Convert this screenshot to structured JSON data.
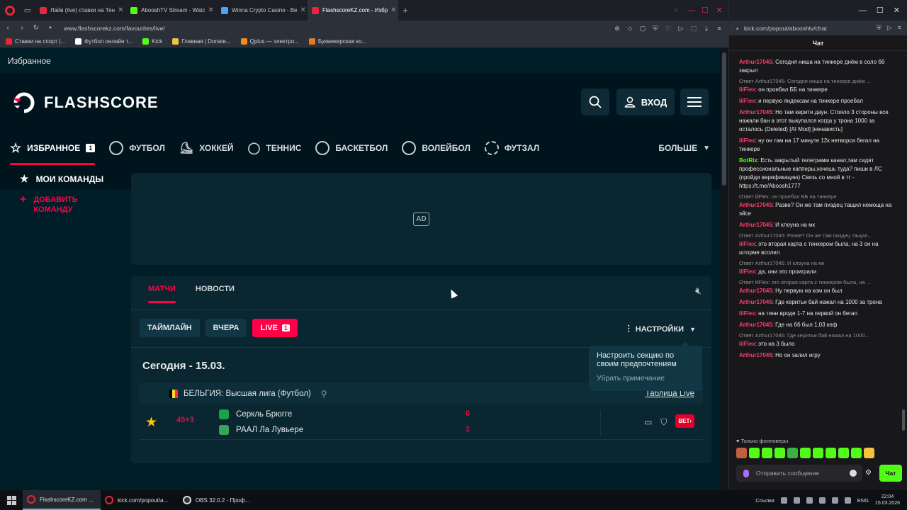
{
  "browser": {
    "tabs": [
      {
        "title": "Лайв (live) ставки на Тен",
        "color": "#e5263c",
        "active": false
      },
      {
        "title": "AbooshTV Stream - Watc",
        "color": "#53fc18",
        "active": false
      },
      {
        "title": "Winna Crypto Casino - Be",
        "color": "#4aa3ff",
        "active": false
      },
      {
        "title": "FlashscoreKZ.com - Избр",
        "color": "#e5263c",
        "active": true
      }
    ],
    "url": "www.flashscorekz.com/favourites/live/",
    "bookmarks": [
      {
        "label": "Ставки на спорт |...",
        "color": "#e5263c"
      },
      {
        "label": "Футбол онлайн т...",
        "color": "#ffffff"
      },
      {
        "label": "Kick",
        "color": "#53fc18"
      },
      {
        "label": "Главная | Donate...",
        "color": "#f4c23c"
      },
      {
        "label": "Qplus — электро...",
        "color": "#f08c1a"
      },
      {
        "label": "Букмекерская ко...",
        "color": "#e67a22"
      }
    ]
  },
  "page": {
    "favourites_heading": "Избранное",
    "logo_text": "FLASHSCORE",
    "login_label": "ВХОД",
    "sports": [
      {
        "label": "ИЗБРАННОЕ",
        "badge": "1",
        "active": true
      },
      {
        "label": "ФУТБОЛ",
        "badge": "",
        "active": false
      },
      {
        "label": "ХОККЕЙ",
        "badge": "",
        "active": false
      },
      {
        "label": "ТЕННИС",
        "badge": "",
        "active": false
      },
      {
        "label": "БАСКЕТБОЛ",
        "badge": "",
        "active": false
      },
      {
        "label": "ВОЛЕЙБОЛ",
        "badge": "",
        "active": false
      },
      {
        "label": "ФУТЗАЛ",
        "badge": "",
        "active": false
      }
    ],
    "more_label": "БОЛЬШЕ",
    "my_teams": "МОИ КОМАНДЫ",
    "add_team": "ДОБАВИТЬ КОМАНДУ",
    "ad_label": "AD",
    "content_tabs": {
      "matches": "МАТЧИ",
      "news": "НОВОСТИ"
    },
    "filters": {
      "timeline": "ТАЙМЛАЙН",
      "yesterday": "ВЧЕРА",
      "live": "LIVE",
      "live_count": "1"
    },
    "settings_label": "НАСТРОЙКИ",
    "tooltip": {
      "text": "Настроить секцию по своим предпочтениям",
      "dismiss": "Убрать примечание"
    },
    "date_label": "Сегодня - 15.03.",
    "league": {
      "name": "БЕЛЬГИЯ: Высшая лига (Футбол)",
      "table_link": "Таблица Live"
    },
    "match": {
      "time": "45+3",
      "home": "Серкль Брюгге",
      "away": "РААЛ Ла Лувьере",
      "home_score": "0",
      "away_score": "1",
      "bet_label": "BET"
    },
    "accent_color": "#ff0046"
  },
  "chat": {
    "url": "kick.com/popout/abooshtv/chat",
    "title": "Чат",
    "messages": [
      {
        "reply": "",
        "nick": "Arthur17045",
        "nick_color": "#ff3b6b",
        "text": "Сегодня ниша на тинкере днём в соло бб закрыл"
      },
      {
        "reply": "Ответ Arthur17045: Сегодня ниша на тинкере днём ...",
        "nick": "lilFlex",
        "nick_color": "#ff3b6b",
        "text": "он проебал ББ на тинкере"
      },
      {
        "reply": "",
        "nick": "lilFlex",
        "nick_color": "#ff3b6b",
        "text": "и первую яндексам на тинкере проебал"
      },
      {
        "reply": "",
        "nick": "Arthur17045",
        "nick_color": "#ff3b6b",
        "text": "Но там керити даун. Стояло 3 стороны все нажали бан а этот выкупался когда у трона 1000 за осталось (Deleted) [AI Mod] [ненависть]"
      },
      {
        "reply": "",
        "nick": "lilFlex",
        "nick_color": "#ff3b6b",
        "text": "ну он там на 17 минуте 12к нетворса бегал на тинкере"
      },
      {
        "reply": "",
        "nick": "BotRix",
        "nick_color": "#53fc18",
        "text": "Есть закрытый телеграмм канал,там сидят профессиональные капперы,хочешь туда? пиши в ЛС (пройди верификацию) Связь со мной в тг - https://t.me/Aboosh1777"
      },
      {
        "reply": "Ответ lilFlex: он проебал ББ на тинкере",
        "nick": "Arthur17045",
        "nick_color": "#ff3b6b",
        "text": "Разве? Он же там пиздец тащил немоща на эйсе"
      },
      {
        "reply": "",
        "nick": "Arthur17045",
        "nick_color": "#ff3b6b",
        "text": "И клоуна на мк"
      },
      {
        "reply": "Ответ Arthur17045: Разве? Он же там пиздец тащил...",
        "nick": "lilFlex",
        "nick_color": "#ff3b6b",
        "text": "это вторая карта с тинкером была, на 3 он на шторме всолил"
      },
      {
        "reply": "Ответ Arthur17045: И клоуна на мк",
        "nick": "lilFlex",
        "nick_color": "#ff3b6b",
        "text": "да, они это проиграли"
      },
      {
        "reply": "Ответ lilFlex: это вторая карта с тинкером была, на ...",
        "nick": "Arthur17045",
        "nick_color": "#ff3b6b",
        "text": "Ну первую на ком он был"
      },
      {
        "reply": "",
        "nick": "Arthur17045",
        "nick_color": "#ff3b6b",
        "text": "Где керитьи бай нажал на 1000 за трона"
      },
      {
        "reply": "",
        "nick": "lilFlex",
        "nick_color": "#ff3b6b",
        "text": "на тини вроде 1-7 на первой он бегал"
      },
      {
        "reply": "",
        "nick": "Arthur17045",
        "nick_color": "#ff3b6b",
        "text": "Где на бб был 1,03 кеф"
      },
      {
        "reply": "Ответ Arthur17045: Где керитьи бай нажал на 1000...",
        "nick": "lilFlex",
        "nick_color": "#ff3b6b",
        "text": "это на 3 было"
      },
      {
        "reply": "",
        "nick": "Arthur17045",
        "nick_color": "#ff3b6b",
        "text": "Но он залил игру"
      }
    ],
    "followers_only": "Только фолловеры",
    "input_placeholder": "Отправить сообщение",
    "send_label": "Чат"
  },
  "taskbar": {
    "tasks": [
      {
        "label": "FlashscoreKZ.com ...",
        "active": true
      },
      {
        "label": "kick.com/popout/a...",
        "active": false
      },
      {
        "label": "OBS 32.0.2 - Проф...",
        "active": false
      }
    ],
    "links_label": "Ссылки",
    "lang": "ENG",
    "time": "22:04",
    "date": "15.03.2026"
  }
}
